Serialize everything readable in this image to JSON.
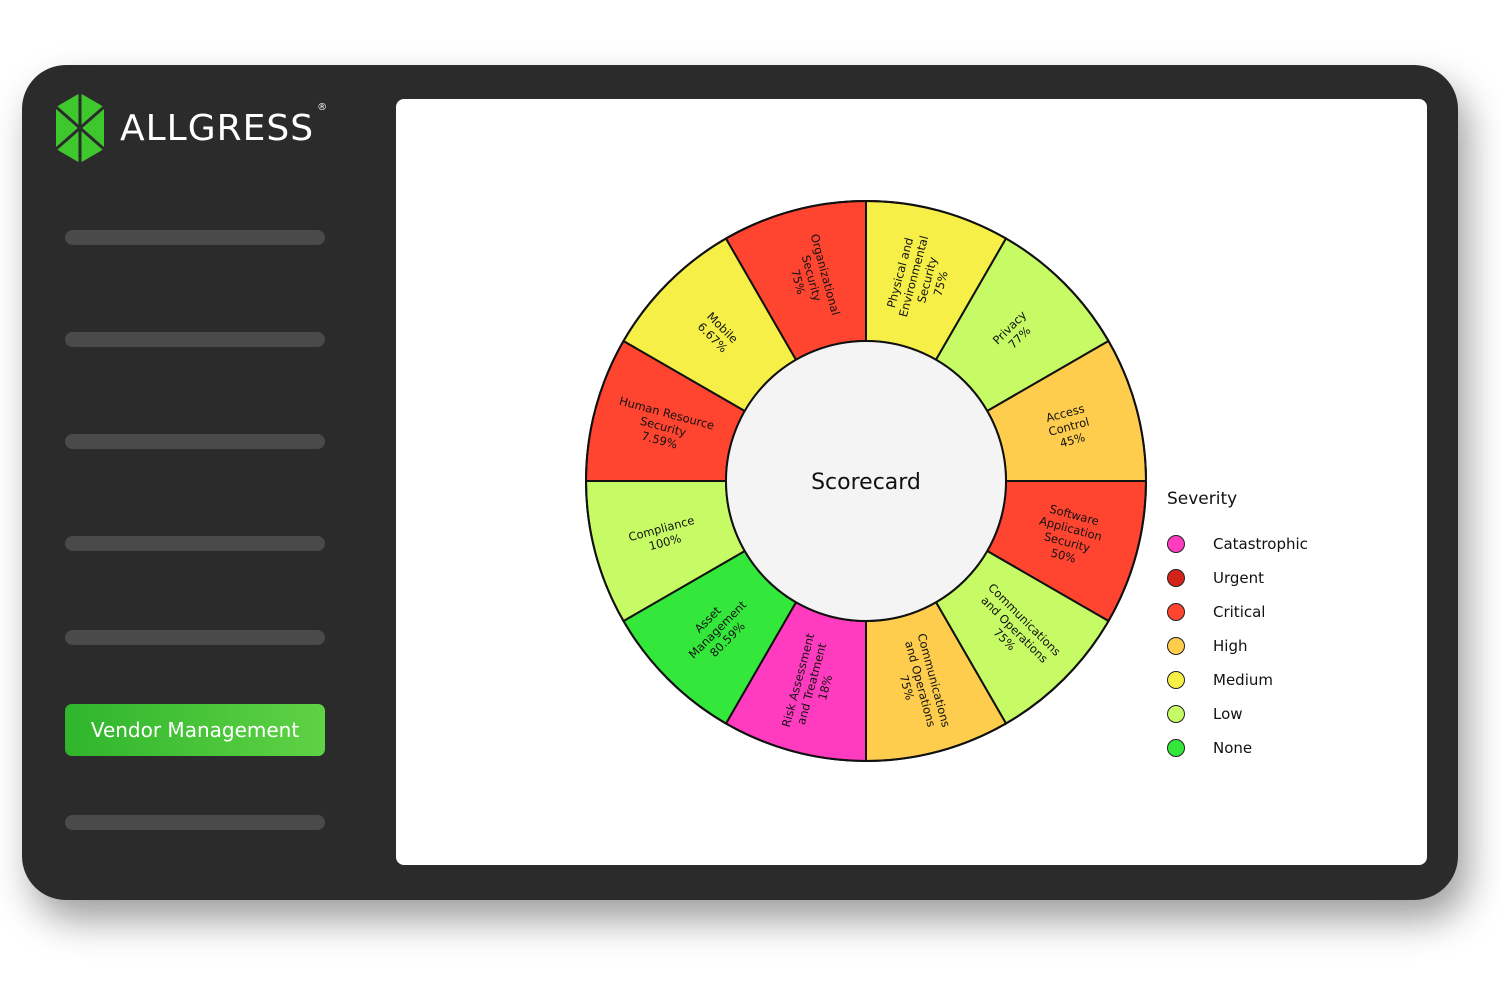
{
  "brand": {
    "name": "ALLGRESS",
    "registered_mark": "®",
    "logo_color": "#3ec82e"
  },
  "sidebar": {
    "active_item_label": "Vendor Management",
    "accent": "#3ec82e"
  },
  "chart_data": {
    "type": "pie",
    "title": "Scorecard",
    "slices": [
      {
        "label": "Physical and Environmental Security",
        "value": "75%",
        "severity": "Medium"
      },
      {
        "label": "Privacy",
        "value": "77%",
        "severity": "Low"
      },
      {
        "label": "Access Control",
        "value": "45%",
        "severity": "High"
      },
      {
        "label": "Software Application Security",
        "value": "50%",
        "severity": "Critical"
      },
      {
        "label": "Communications and Operations",
        "value": "75%",
        "severity": "Low"
      },
      {
        "label": "Communications and Operations",
        "value": "75%",
        "severity": "High"
      },
      {
        "label": "Risk Assessment and Treatment",
        "value": "18%",
        "severity": "Catastrophic"
      },
      {
        "label": "Asset Management",
        "value": "80.59%",
        "severity": "None"
      },
      {
        "label": "Compliance",
        "value": "100%",
        "severity": "Low"
      },
      {
        "label": "Human Resource Security",
        "value": "7.59%",
        "severity": "Critical"
      },
      {
        "label": "Mobile",
        "value": "6.67%",
        "severity": "Medium"
      },
      {
        "label": "Organizational Security",
        "value": "75%",
        "severity": "Critical"
      }
    ],
    "legend": {
      "title": "Severity",
      "position": "right",
      "items": [
        {
          "label": "Catastrophic",
          "color": "#ff3cc0"
        },
        {
          "label": "Urgent",
          "color": "#d4241a"
        },
        {
          "label": "Critical",
          "color": "#ff4530"
        },
        {
          "label": "High",
          "color": "#ffcd4d"
        },
        {
          "label": "Medium",
          "color": "#f6ef48"
        },
        {
          "label": "Low",
          "color": "#c6fb66"
        },
        {
          "label": "None",
          "color": "#34e83b"
        }
      ]
    }
  }
}
